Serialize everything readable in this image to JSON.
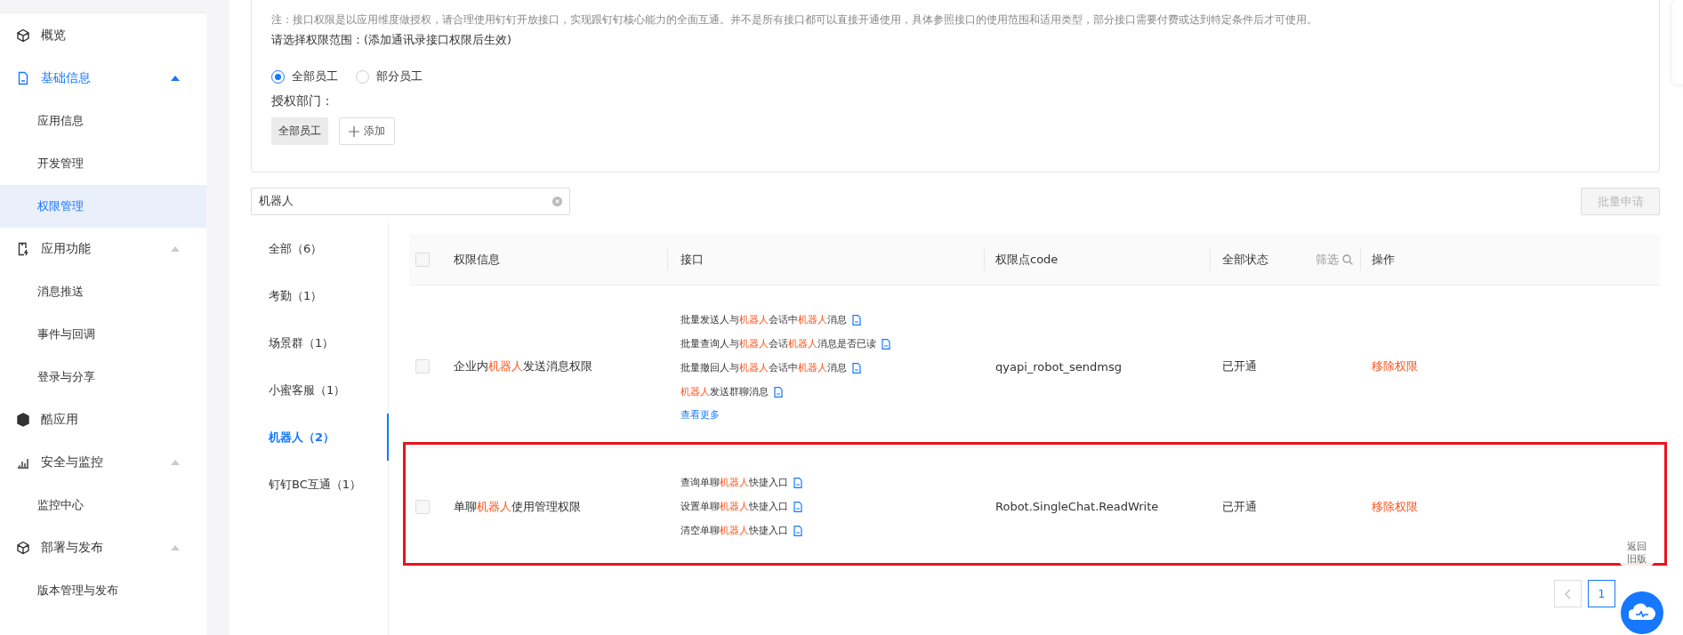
{
  "sidebar": {
    "items": [
      {
        "label": "概览",
        "kind": "cube",
        "selected": false
      },
      {
        "label": "基础信息",
        "kind": "doc",
        "selected": true,
        "expanded": true,
        "children": [
          {
            "label": "应用信息",
            "selected": false
          },
          {
            "label": "开发管理",
            "selected": false
          },
          {
            "label": "权限管理",
            "selected": true
          }
        ]
      },
      {
        "label": "应用功能",
        "kind": "phone",
        "selected": false,
        "expanded": true,
        "children": [
          {
            "label": "消息推送",
            "selected": false
          },
          {
            "label": "事件与回调",
            "selected": false
          },
          {
            "label": "登录与分享",
            "selected": false
          }
        ]
      },
      {
        "label": "酷应用",
        "kind": "box",
        "selected": false
      },
      {
        "label": "安全与监控",
        "kind": "chart",
        "selected": false,
        "expanded": true,
        "children": [
          {
            "label": "监控中心",
            "selected": false
          }
        ]
      },
      {
        "label": "部署与发布",
        "kind": "cube",
        "selected": false,
        "expanded": true,
        "children": [
          {
            "label": "版本管理与发布",
            "selected": false
          }
        ]
      }
    ]
  },
  "scope": {
    "note": "注：接口权限是以应用维度做授权，请合理使用钉钉开放接口，实现跟钉钉核心能力的全面互通。并不是所有接口都可以直接开通使用，具体参照接口的使用范围和适用类型，部分接口需要付费或达到特定条件后才可使用。",
    "prompt": "请选择权限范围：(添加通讯录接口权限后生效)",
    "options": [
      {
        "label": "全部员工",
        "selected": true
      },
      {
        "label": "部分员工",
        "selected": false
      }
    ],
    "dept_label": "授权部门：",
    "dept_tags": [
      "全部员工"
    ],
    "add_button": "添加"
  },
  "search": {
    "value": "机器人"
  },
  "batch_button": {
    "label": "批量申请",
    "disabled": true
  },
  "categories": [
    {
      "label": "全部（6）",
      "selected": false
    },
    {
      "label": "考勤（1）",
      "selected": false
    },
    {
      "label": "场景群（1）",
      "selected": false
    },
    {
      "label": "小蜜客服（1）",
      "selected": false
    },
    {
      "label": "机器人（2）",
      "selected": true
    },
    {
      "label": "钉钉BC互通（1）",
      "selected": false
    }
  ],
  "table": {
    "all_checked": false,
    "columns": [
      "权限信息",
      "接口",
      "权限点code",
      "全部状态",
      "操作"
    ],
    "filter": "筛选",
    "rows": [
      {
        "checked": false,
        "name": [
          {
            "text": "企业内",
            "hl": false
          },
          {
            "text": "机器人",
            "hl": true
          },
          {
            "text": "发送消息权限",
            "hl": false
          }
        ],
        "apis": [
          [
            {
              "text": "批量发送人与",
              "hl": false
            },
            {
              "text": "机器人",
              "hl": true
            },
            {
              "text": "会话中",
              "hl": false
            },
            {
              "text": "机器人",
              "hl": true
            },
            {
              "text": "消息",
              "hl": false
            }
          ],
          [
            {
              "text": "批量查询人与",
              "hl": false
            },
            {
              "text": "机器人",
              "hl": true
            },
            {
              "text": "会话",
              "hl": false
            },
            {
              "text": "机器人",
              "hl": true
            },
            {
              "text": "消息是否已读",
              "hl": false
            }
          ],
          [
            {
              "text": "批量撤回人与",
              "hl": false
            },
            {
              "text": "机器人",
              "hl": true
            },
            {
              "text": "会话中",
              "hl": false
            },
            {
              "text": "机器人",
              "hl": true
            },
            {
              "text": "消息",
              "hl": false
            }
          ],
          [
            {
              "text": "机器人",
              "hl": true
            },
            {
              "text": "发送群聊消息",
              "hl": false
            }
          ]
        ],
        "more": "查看更多",
        "code": "qyapi_robot_sendmsg",
        "status": "已开通",
        "action": "移除权限",
        "highlighted": false
      },
      {
        "checked": false,
        "name": [
          {
            "text": "单聊",
            "hl": false
          },
          {
            "text": "机器人",
            "hl": true
          },
          {
            "text": "使用管理权限",
            "hl": false
          }
        ],
        "apis": [
          [
            {
              "text": "查询单聊",
              "hl": false
            },
            {
              "text": "机器人",
              "hl": true
            },
            {
              "text": "快捷入口",
              "hl": false
            }
          ],
          [
            {
              "text": "设置单聊",
              "hl": false
            },
            {
              "text": "机器人",
              "hl": true
            },
            {
              "text": "快捷入口",
              "hl": false
            }
          ],
          [
            {
              "text": "清空单聊",
              "hl": false
            },
            {
              "text": "机器人",
              "hl": true
            },
            {
              "text": "快捷入口",
              "hl": false
            }
          ]
        ],
        "code": "Robot.SingleChat.ReadWrite",
        "status": "已开通",
        "action": "移除权限",
        "highlighted": true
      }
    ]
  },
  "old_version": "返回旧版",
  "pagination": {
    "pages": [
      {
        "label": "1",
        "selected": true
      }
    ]
  }
}
